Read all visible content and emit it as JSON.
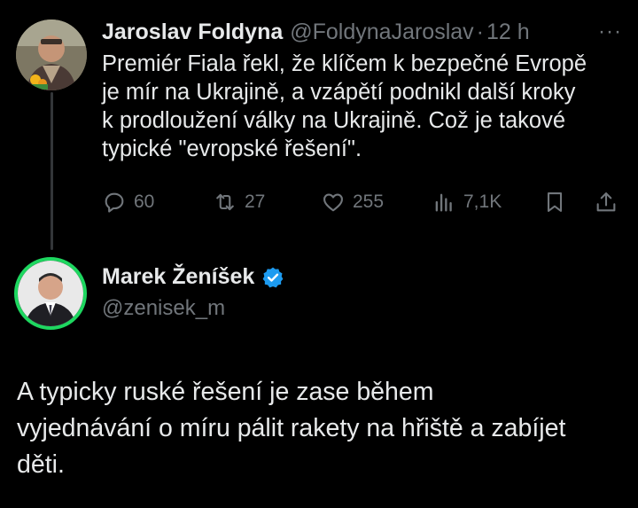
{
  "tweet1": {
    "author_name": "Jaroslav Foldyna",
    "handle": "@FoldynaJaroslav",
    "separator": "·",
    "time": "12 h",
    "more": "···",
    "lines": [
      "Premiér Fiala řekl, že klíčem k bezpečné Evropě",
      "je mír na Ukrajině, a vzápětí podnikl další kroky",
      "k prodloužení války na Ukrajině. Což je takové",
      "typické \"evropské řešení\"."
    ],
    "stats": {
      "replies": "60",
      "reposts": "27",
      "likes": "255",
      "views": "7,1K"
    }
  },
  "tweet2": {
    "author_name": "Marek Ženíšek",
    "handle": "@zenisek_m",
    "lines": [
      "A typicky ruské řešení je zase během",
      "vyjednávání o míru pálit rakety na hřiště a zabíjet",
      "děti."
    ]
  },
  "colors": {
    "background": "#000000",
    "text": "#e7e9ea",
    "muted": "#71767b",
    "verified": "#1d9bf0",
    "avatar_ring": "#1ed760"
  }
}
